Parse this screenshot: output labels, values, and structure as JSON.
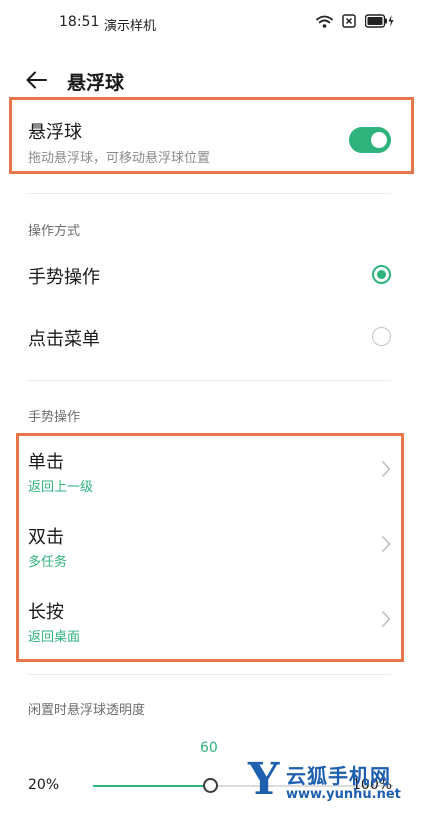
{
  "status_bar": {
    "time": "18:51",
    "carrier": "演示样机",
    "icons": [
      "wifi-icon",
      "sim-blocked-icon",
      "battery-charging-icon"
    ]
  },
  "header": {
    "title": "悬浮球",
    "back_icon": "arrow-left-icon"
  },
  "main_toggle": {
    "title": "悬浮球",
    "subtitle": "拖动悬浮球，可移动悬浮球位置",
    "enabled": true
  },
  "operation_mode": {
    "label": "操作方式",
    "options": [
      {
        "label": "手势操作",
        "selected": true
      },
      {
        "label": "点击菜单",
        "selected": false
      }
    ]
  },
  "gestures": {
    "label": "手势操作",
    "items": [
      {
        "title": "单击",
        "action": "返回上一级"
      },
      {
        "title": "双击",
        "action": "多任务"
      },
      {
        "title": "长按",
        "action": "返回桌面"
      }
    ]
  },
  "opacity": {
    "label": "闲置时悬浮球透明度",
    "value": "60",
    "min_label": "20%",
    "max_label": "100%",
    "min": 20,
    "max": 100,
    "current": 60
  },
  "watermark": {
    "letter": "Y",
    "name": "云狐手机网",
    "url": "www.yunhu.net"
  },
  "colors": {
    "accent": "#2fb37c",
    "highlight": "#e9754a",
    "watermark": "#1f5fb0"
  }
}
